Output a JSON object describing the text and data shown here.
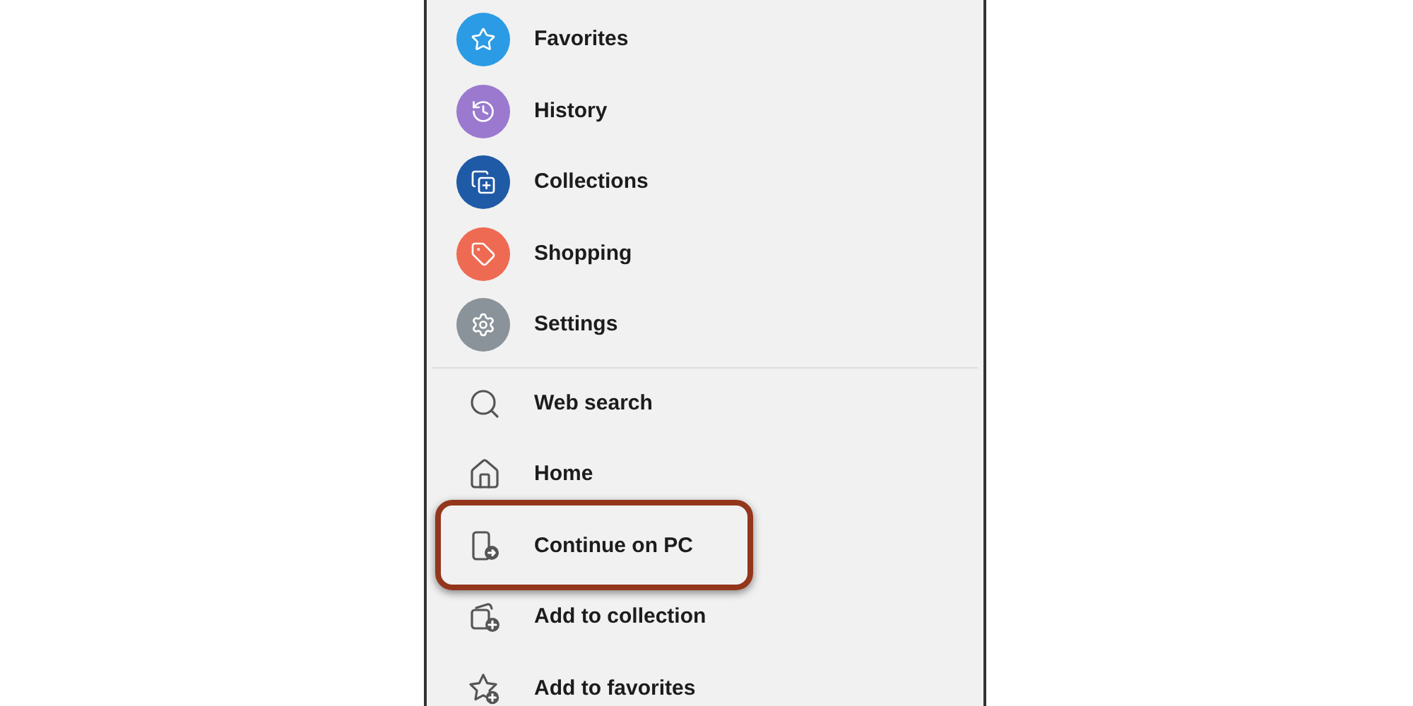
{
  "menu": {
    "primary_items": [
      {
        "label": "Favorites",
        "color": "#2b9be6"
      },
      {
        "label": "History",
        "color": "#9a79cf"
      },
      {
        "label": "Collections",
        "color": "#1f5aa6"
      },
      {
        "label": "Shopping",
        "color": "#ef6a52"
      },
      {
        "label": "Settings",
        "color": "#8a9399"
      }
    ],
    "secondary_items": [
      {
        "label": "Web search",
        "highlighted": false
      },
      {
        "label": "Home",
        "highlighted": false
      },
      {
        "label": "Continue on PC",
        "highlighted": true
      },
      {
        "label": "Add to collection",
        "highlighted": false
      },
      {
        "label": "Add to favorites",
        "highlighted": false
      }
    ]
  }
}
